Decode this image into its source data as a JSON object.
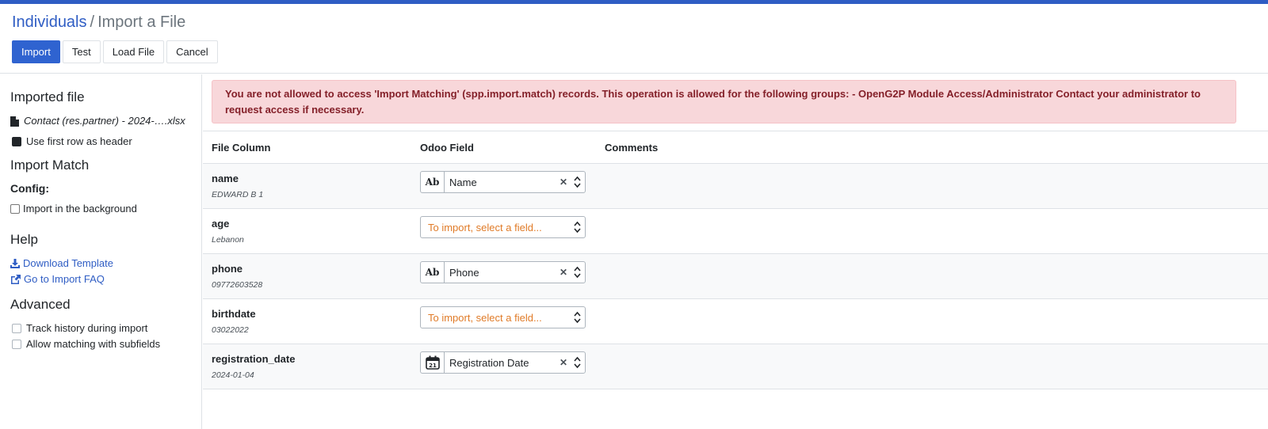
{
  "breadcrumb": {
    "parent": "Individuals",
    "separator": "/",
    "current": "Import a File"
  },
  "buttons": {
    "import": "Import",
    "test": "Test",
    "load_file": "Load File",
    "cancel": "Cancel"
  },
  "sidebar": {
    "imported_file_title": "Imported file",
    "file_name": "Contact (res.partner) - 2024-….xlsx",
    "first_row_header": "Use first row as header",
    "import_match_title": "Import Match",
    "config_label": "Config:",
    "import_background": "Import in the background",
    "help_title": "Help",
    "download_template": "Download Template",
    "import_faq": "Go to Import FAQ",
    "advanced_title": "Advanced",
    "track_history": "Track history during import",
    "allow_subfields": "Allow matching with subfields"
  },
  "alert": {
    "message": "You are not allowed to access 'Import Matching' (spp.import.match) records. This operation is allowed for the following groups: - OpenG2P Module Access/Administrator Contact your administrator to request access if necessary."
  },
  "table": {
    "headers": {
      "file_column": "File Column",
      "odoo_field": "Odoo Field",
      "comments": "Comments"
    },
    "placeholder": "To import, select a field...",
    "rows": [
      {
        "name": "name",
        "sample": "EDWARD B 1",
        "field": "Name",
        "icon": "text-type-icon",
        "icon_text": "Ab"
      },
      {
        "name": "age",
        "sample": "Lebanon",
        "field": "",
        "icon": "",
        "icon_text": ""
      },
      {
        "name": "phone",
        "sample": "09772603528",
        "field": "Phone",
        "icon": "text-type-icon",
        "icon_text": "Ab"
      },
      {
        "name": "birthdate",
        "sample": "03022022",
        "field": "",
        "icon": "",
        "icon_text": ""
      },
      {
        "name": "registration_date",
        "sample": "2024-01-04",
        "field": "Registration Date",
        "icon": "calendar-icon",
        "icon_text": "21"
      }
    ]
  },
  "colors": {
    "primary": "#2f63d0",
    "alert_bg": "#f8d7da",
    "alert_text": "#842029",
    "placeholder": "#e07b28"
  }
}
